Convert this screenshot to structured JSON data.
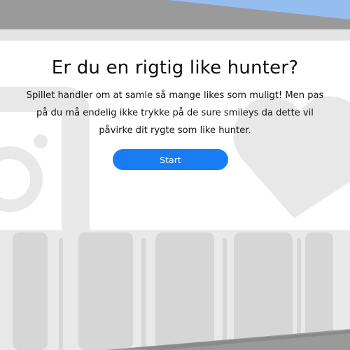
{
  "colors": {
    "background_gray": "#e9e9e9",
    "shape_gray": "#d7d7d7",
    "panel_white": "#ffffff",
    "sky_blue": "#96bdf0",
    "dark_band": "#9a9a9a",
    "button_blue": "#1a7cf2"
  },
  "background_icons": [
    "instagram-logo-icon",
    "heart-icon",
    "film-strip-icon"
  ],
  "intro": {
    "title": "Er du en rigtig like hunter?",
    "description": "Spillet handler om at samle så mange likes som muligt! Men pas på du må endelig ikke trykke på de sure smileys da dette vil påvirke dit rygte som like hunter.",
    "start_label": "Start"
  }
}
